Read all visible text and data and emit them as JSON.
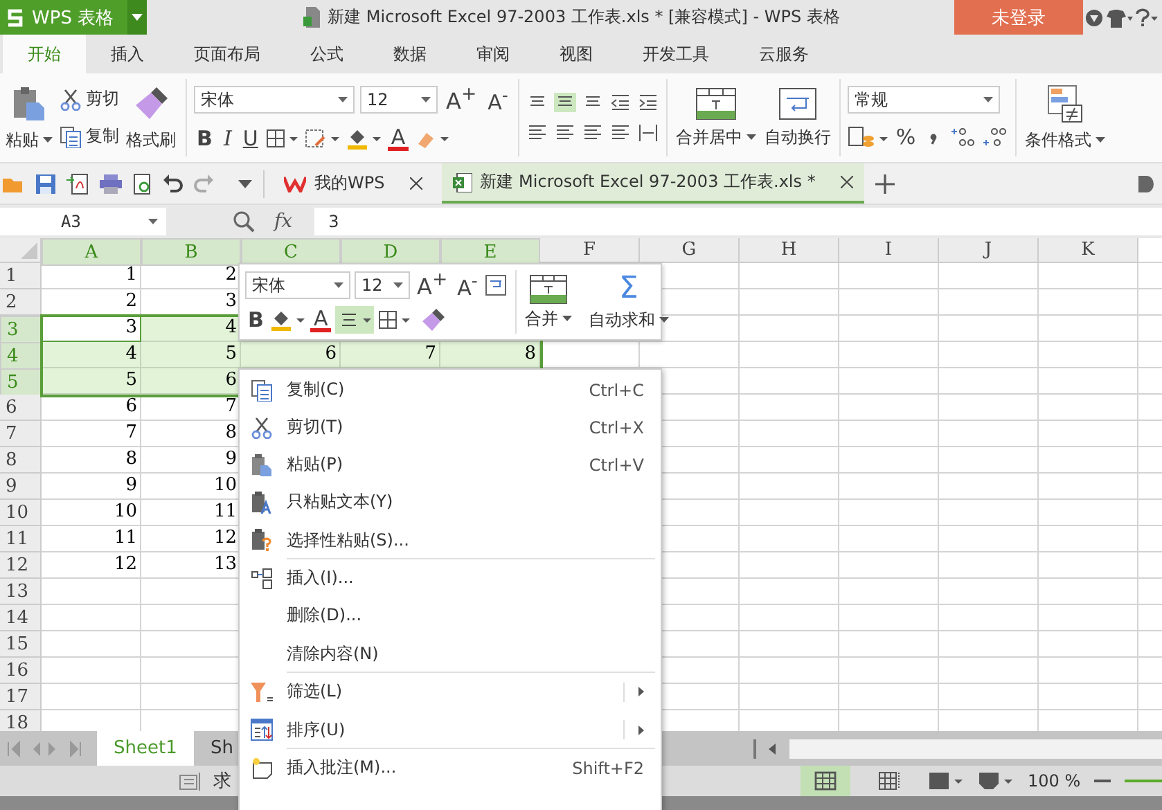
{
  "app_menu": {
    "label": "WPS 表格"
  },
  "window": {
    "title": "新建 Microsoft Excel 97-2003 工作表.xls * [兼容模式] - WPS 表格"
  },
  "login_button": "未登录",
  "ribbon_tabs": [
    {
      "label": "开始",
      "selected": true
    },
    {
      "label": "插入",
      "selected": false
    },
    {
      "label": "页面布局",
      "selected": false
    },
    {
      "label": "公式",
      "selected": false
    },
    {
      "label": "数据",
      "selected": false
    },
    {
      "label": "审阅",
      "selected": false
    },
    {
      "label": "视图",
      "selected": false
    },
    {
      "label": "开发工具",
      "selected": false
    },
    {
      "label": "云服务",
      "selected": false
    }
  ],
  "ribbon": {
    "paste": "粘贴",
    "cut": "剪切",
    "copy": "复制",
    "format_painter": "格式刷",
    "font_name": "宋体",
    "font_size": "12",
    "grow": "A$^{+}$",
    "shrink": "A$^{-}$",
    "bold": "B",
    "italic": "I",
    "underline": "U",
    "font_color": "A",
    "merge": "合并居中",
    "wrap": "自动换行",
    "number_format": "常规",
    "percent": "%",
    "conditional_format": "条件格式"
  },
  "doc_tabs": [
    {
      "kind": "home",
      "label": "我的WPS",
      "selected": false
    },
    {
      "kind": "sheet",
      "label": "新建 Microsoft Excel 97-2003 工作表.xls *",
      "selected": true
    }
  ],
  "formula_bar": {
    "name_box": "A3",
    "fx": "fx",
    "value": "3"
  },
  "columns": [
    {
      "label": "A",
      "selected": true
    },
    {
      "label": "B",
      "selected": true
    },
    {
      "label": "C",
      "selected": true
    },
    {
      "label": "D",
      "selected": true
    },
    {
      "label": "E",
      "selected": true
    },
    {
      "label": "F",
      "selected": false
    },
    {
      "label": "G",
      "selected": false
    },
    {
      "label": "H",
      "selected": false
    },
    {
      "label": "I",
      "selected": false
    },
    {
      "label": "J",
      "selected": false
    },
    {
      "label": "K",
      "selected": false
    }
  ],
  "rows": [
    {
      "label": "1",
      "selected": false,
      "active": false,
      "cells": [
        "1",
        "2"
      ]
    },
    {
      "label": "2",
      "selected": false,
      "active": false,
      "cells": [
        "2",
        "3"
      ]
    },
    {
      "label": "3",
      "selected": true,
      "active": true,
      "cells": [
        "3",
        "4"
      ]
    },
    {
      "label": "4",
      "selected": true,
      "active": false,
      "cells": [
        "4",
        "5",
        "6",
        "7",
        "8"
      ]
    },
    {
      "label": "5",
      "selected": true,
      "active": false,
      "cells": [
        "5",
        "6"
      ]
    },
    {
      "label": "6",
      "selected": false,
      "active": false,
      "cells": [
        "6",
        "7"
      ]
    },
    {
      "label": "7",
      "selected": false,
      "active": false,
      "cells": [
        "7",
        "8"
      ]
    },
    {
      "label": "8",
      "selected": false,
      "active": false,
      "cells": [
        "8",
        "9"
      ]
    },
    {
      "label": "9",
      "selected": false,
      "active": false,
      "cells": [
        "9",
        "10"
      ]
    },
    {
      "label": "10",
      "selected": false,
      "active": false,
      "cells": [
        "10",
        "11"
      ]
    },
    {
      "label": "11",
      "selected": false,
      "active": false,
      "cells": [
        "11",
        "12"
      ]
    },
    {
      "label": "12",
      "selected": false,
      "active": false,
      "cells": [
        "12",
        "13"
      ]
    },
    {
      "label": "13",
      "selected": false,
      "active": false,
      "cells": []
    },
    {
      "label": "14",
      "selected": false,
      "active": false,
      "cells": []
    },
    {
      "label": "15",
      "selected": false,
      "active": false,
      "cells": []
    },
    {
      "label": "16",
      "selected": false,
      "active": false,
      "cells": []
    },
    {
      "label": "17",
      "selected": false,
      "active": false,
      "cells": []
    },
    {
      "label": "18",
      "selected": false,
      "active": false,
      "cells": []
    }
  ],
  "mini_toolbar": {
    "font_name": "宋体",
    "font_size": "12",
    "grow": "A$^{+}$",
    "shrink": "A$^{-}$",
    "bold": "B",
    "font_color": "A",
    "merge": "合并",
    "autosum_symbol": "Σ",
    "autosum": "自动求和"
  },
  "context_menu": [
    {
      "kind": "copy",
      "label": "复制(C)",
      "shortcut": "Ctrl+C",
      "submenu": false,
      "separator_after": false
    },
    {
      "kind": "cut",
      "label": "剪切(T)",
      "shortcut": "Ctrl+X",
      "submenu": false,
      "separator_after": false
    },
    {
      "kind": "paste",
      "label": "粘贴(P)",
      "shortcut": "Ctrl+V",
      "submenu": false,
      "separator_after": false
    },
    {
      "kind": "paste-text",
      "label": "只粘贴文本(Y)",
      "submenu": false,
      "separator_after": false
    },
    {
      "kind": "paste-special",
      "label": "选择性粘贴(S)...",
      "submenu": false,
      "separator_after": true
    },
    {
      "kind": "insert",
      "label": "插入(I)...",
      "submenu": false,
      "separator_after": false
    },
    {
      "kind": "plain",
      "label": "删除(D)...",
      "submenu": false,
      "separator_after": false
    },
    {
      "kind": "plain",
      "label": "清除内容(N)",
      "submenu": false,
      "separator_after": true
    },
    {
      "kind": "filter",
      "label": "筛选(L)",
      "submenu": true,
      "separator_after": false
    },
    {
      "kind": "sort",
      "label": "排序(U)",
      "submenu": true,
      "separator_after": true
    },
    {
      "kind": "comment",
      "label": "插入批注(M)...",
      "shortcut": "Shift+F2",
      "submenu": false,
      "separator_after": false
    }
  ],
  "sheet_tabs": [
    {
      "label": "Sheet1",
      "selected": true
    },
    {
      "label": "Sh",
      "selected": false
    }
  ],
  "status_bar": {
    "text": "求",
    "views": [
      {
        "kind": "normal",
        "selected": true
      },
      {
        "kind": "page-break",
        "selected": false
      }
    ],
    "zoom": "100 %"
  }
}
